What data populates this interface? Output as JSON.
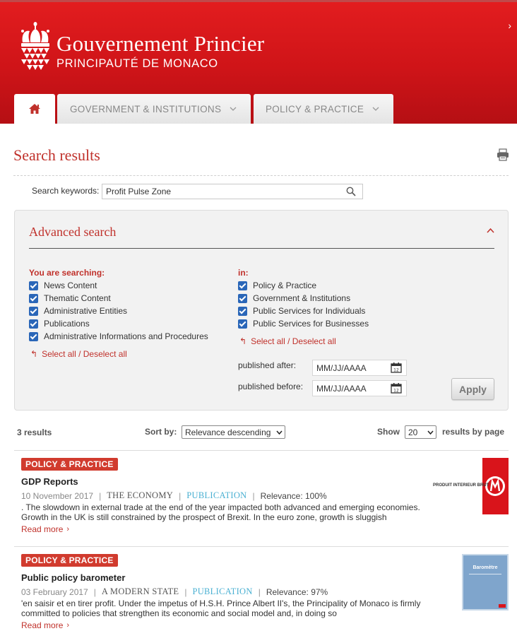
{
  "header": {
    "title": "Gouvernement Princier",
    "subtitle": "PRINCIPAUTÉ DE MONACO",
    "nav_arrow": "›",
    "colors": {
      "brand_red": "#d01a1c",
      "accent_red": "#c0312b",
      "badge_red": "#d13b2e",
      "type_blue": "#4ab0d2",
      "checkbox_blue": "#2a66b8"
    }
  },
  "nav": {
    "home_icon": "home-icon",
    "tabs": [
      {
        "label": "GOVERNMENT & INSTITUTIONS"
      },
      {
        "label": "POLICY & PRACTICE"
      }
    ]
  },
  "page": {
    "title": "Search results",
    "print_icon": "printer-icon"
  },
  "search": {
    "label": "Search keywords:",
    "value": "Profit Pulse Zone",
    "icon": "search-icon"
  },
  "advanced": {
    "title": "Advanced search",
    "left_label": "You are searching:",
    "left_items": [
      {
        "label": "News Content",
        "checked": true
      },
      {
        "label": "Thematic Content",
        "checked": true
      },
      {
        "label": "Administrative Entities",
        "checked": true
      },
      {
        "label": "Publications",
        "checked": true
      },
      {
        "label": "Administrative Informations and Procedures",
        "checked": true
      }
    ],
    "right_label": "in:",
    "right_items": [
      {
        "label": "Policy & Practice",
        "checked": true
      },
      {
        "label": "Government & Institutions",
        "checked": true
      },
      {
        "label": "Public Services for Individuals",
        "checked": true
      },
      {
        "label": "Public Services for Businesses",
        "checked": true
      }
    ],
    "select_all": "Select all / Deselect all",
    "published_after_label": "published after:",
    "published_after_value": "MM/JJ/AAAA",
    "published_before_label": "published before:",
    "published_before_value": "MM/JJ/AAAA",
    "apply_label": "Apply"
  },
  "results_bar": {
    "count": "3 results",
    "sort_label": "Sort by:",
    "sort_value": "Relevance descending",
    "show_label": "Show",
    "show_value": "20",
    "per_page_label": "results by page"
  },
  "results": [
    {
      "badge": "POLICY & PRACTICE",
      "title": "GDP Reports",
      "date": "10 November 2017",
      "theme": "THE ECONOMY",
      "type": "PUBLICATION",
      "relevance": "Relevance: 100%",
      "description": ". The slowdown in external trade at the end of the year impacted both advanced and emerging economies. Growth in the UK is still constrained by the prospect of Brexit. In the euro zone, growth is sluggish",
      "more": "Read more",
      "thumb_text": "Produit Interieur Brut"
    },
    {
      "badge": "POLICY & PRACTICE",
      "title": "Public policy barometer",
      "date": "03 February 2017",
      "theme": "A MODERN STATE",
      "type": "PUBLICATION",
      "relevance": "Relevance: 97%",
      "description": "'en saisir et en tirer profit. Under the impetus of H.S.H. Prince Albert II's, the Principality of Monaco is firmly committed to policies that strengthen its economic and social model and, in doing so",
      "more": "Read more",
      "thumb_text": "Baromètre"
    }
  ]
}
